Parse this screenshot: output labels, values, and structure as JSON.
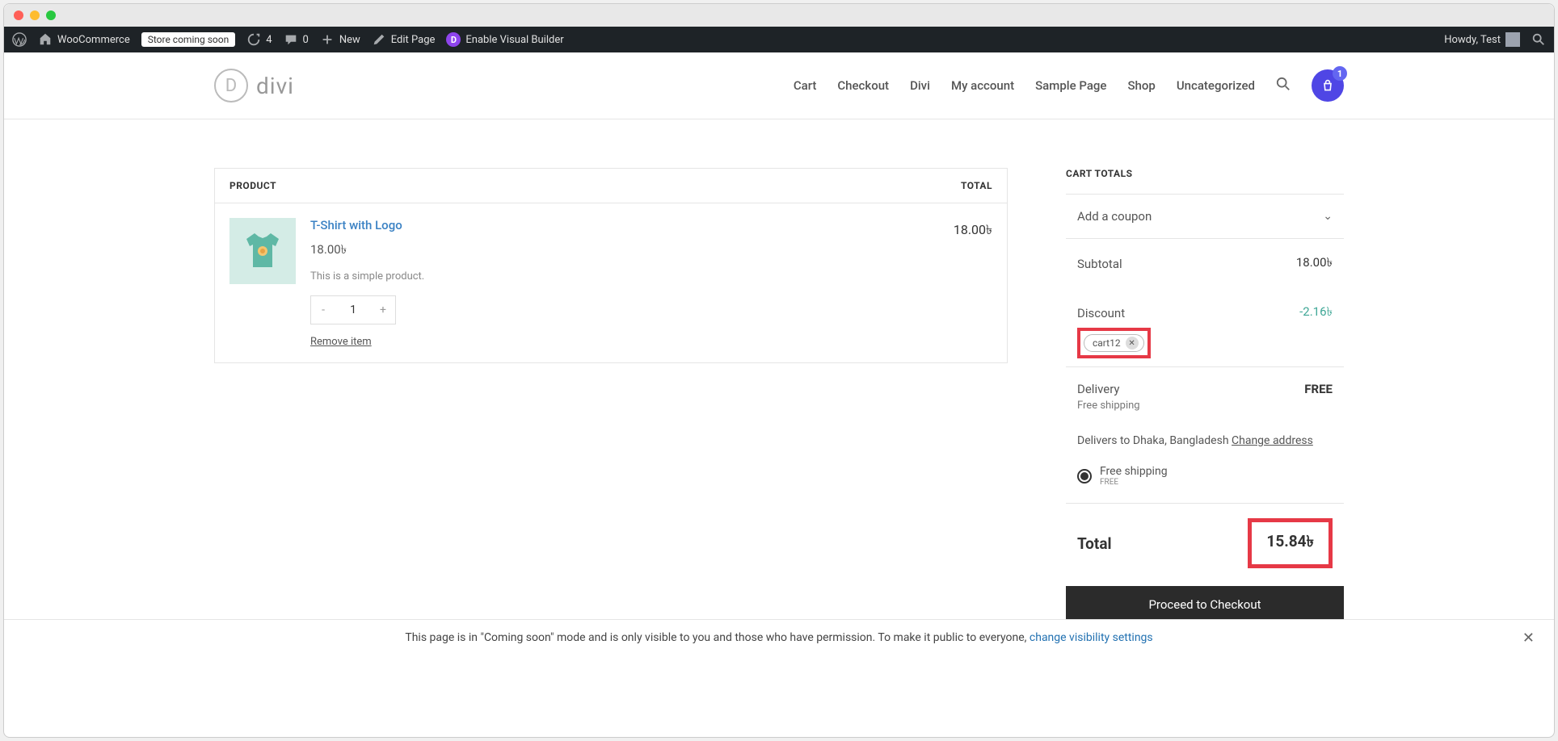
{
  "wp_admin": {
    "site_name": "WooCommerce",
    "store_status": "Store coming soon",
    "updates_count": "4",
    "comments_count": "0",
    "new_label": "New",
    "edit_page_label": "Edit Page",
    "visual_builder_label": "Enable Visual Builder",
    "howdy": "Howdy, Test"
  },
  "header": {
    "logo_letter": "D",
    "logo_text": "divi",
    "nav": [
      "Cart",
      "Checkout",
      "Divi",
      "My account",
      "Sample Page",
      "Shop",
      "Uncategorized"
    ],
    "cart_count": "1"
  },
  "cart_table": {
    "col_product": "PRODUCT",
    "col_total": "TOTAL",
    "product": {
      "title": "T-Shirt with Logo",
      "price": "18.00৳",
      "desc": "This is a simple product.",
      "qty": "1",
      "remove": "Remove item",
      "line_total": "18.00৳"
    }
  },
  "totals": {
    "title": "CART TOTALS",
    "add_coupon": "Add a coupon",
    "subtotal_label": "Subtotal",
    "subtotal_value": "18.00৳",
    "discount_label": "Discount",
    "discount_value": "-2.16৳",
    "coupon_code": "cart12",
    "delivery_label": "Delivery",
    "delivery_value": "FREE",
    "delivery_method": "Free shipping",
    "delivers_to_prefix": "Delivers to Dhaka, Bangladesh ",
    "change_address": "Change address",
    "shipping_option": "Free shipping",
    "shipping_sub": "FREE",
    "total_label": "Total",
    "total_value": "15.84৳",
    "checkout_btn": "Proceed to Checkout"
  },
  "notice": {
    "text": "This page is in \"Coming soon\" mode and is only visible to you and those who have permission. To make it public to everyone, ",
    "link": "change visibility settings"
  }
}
